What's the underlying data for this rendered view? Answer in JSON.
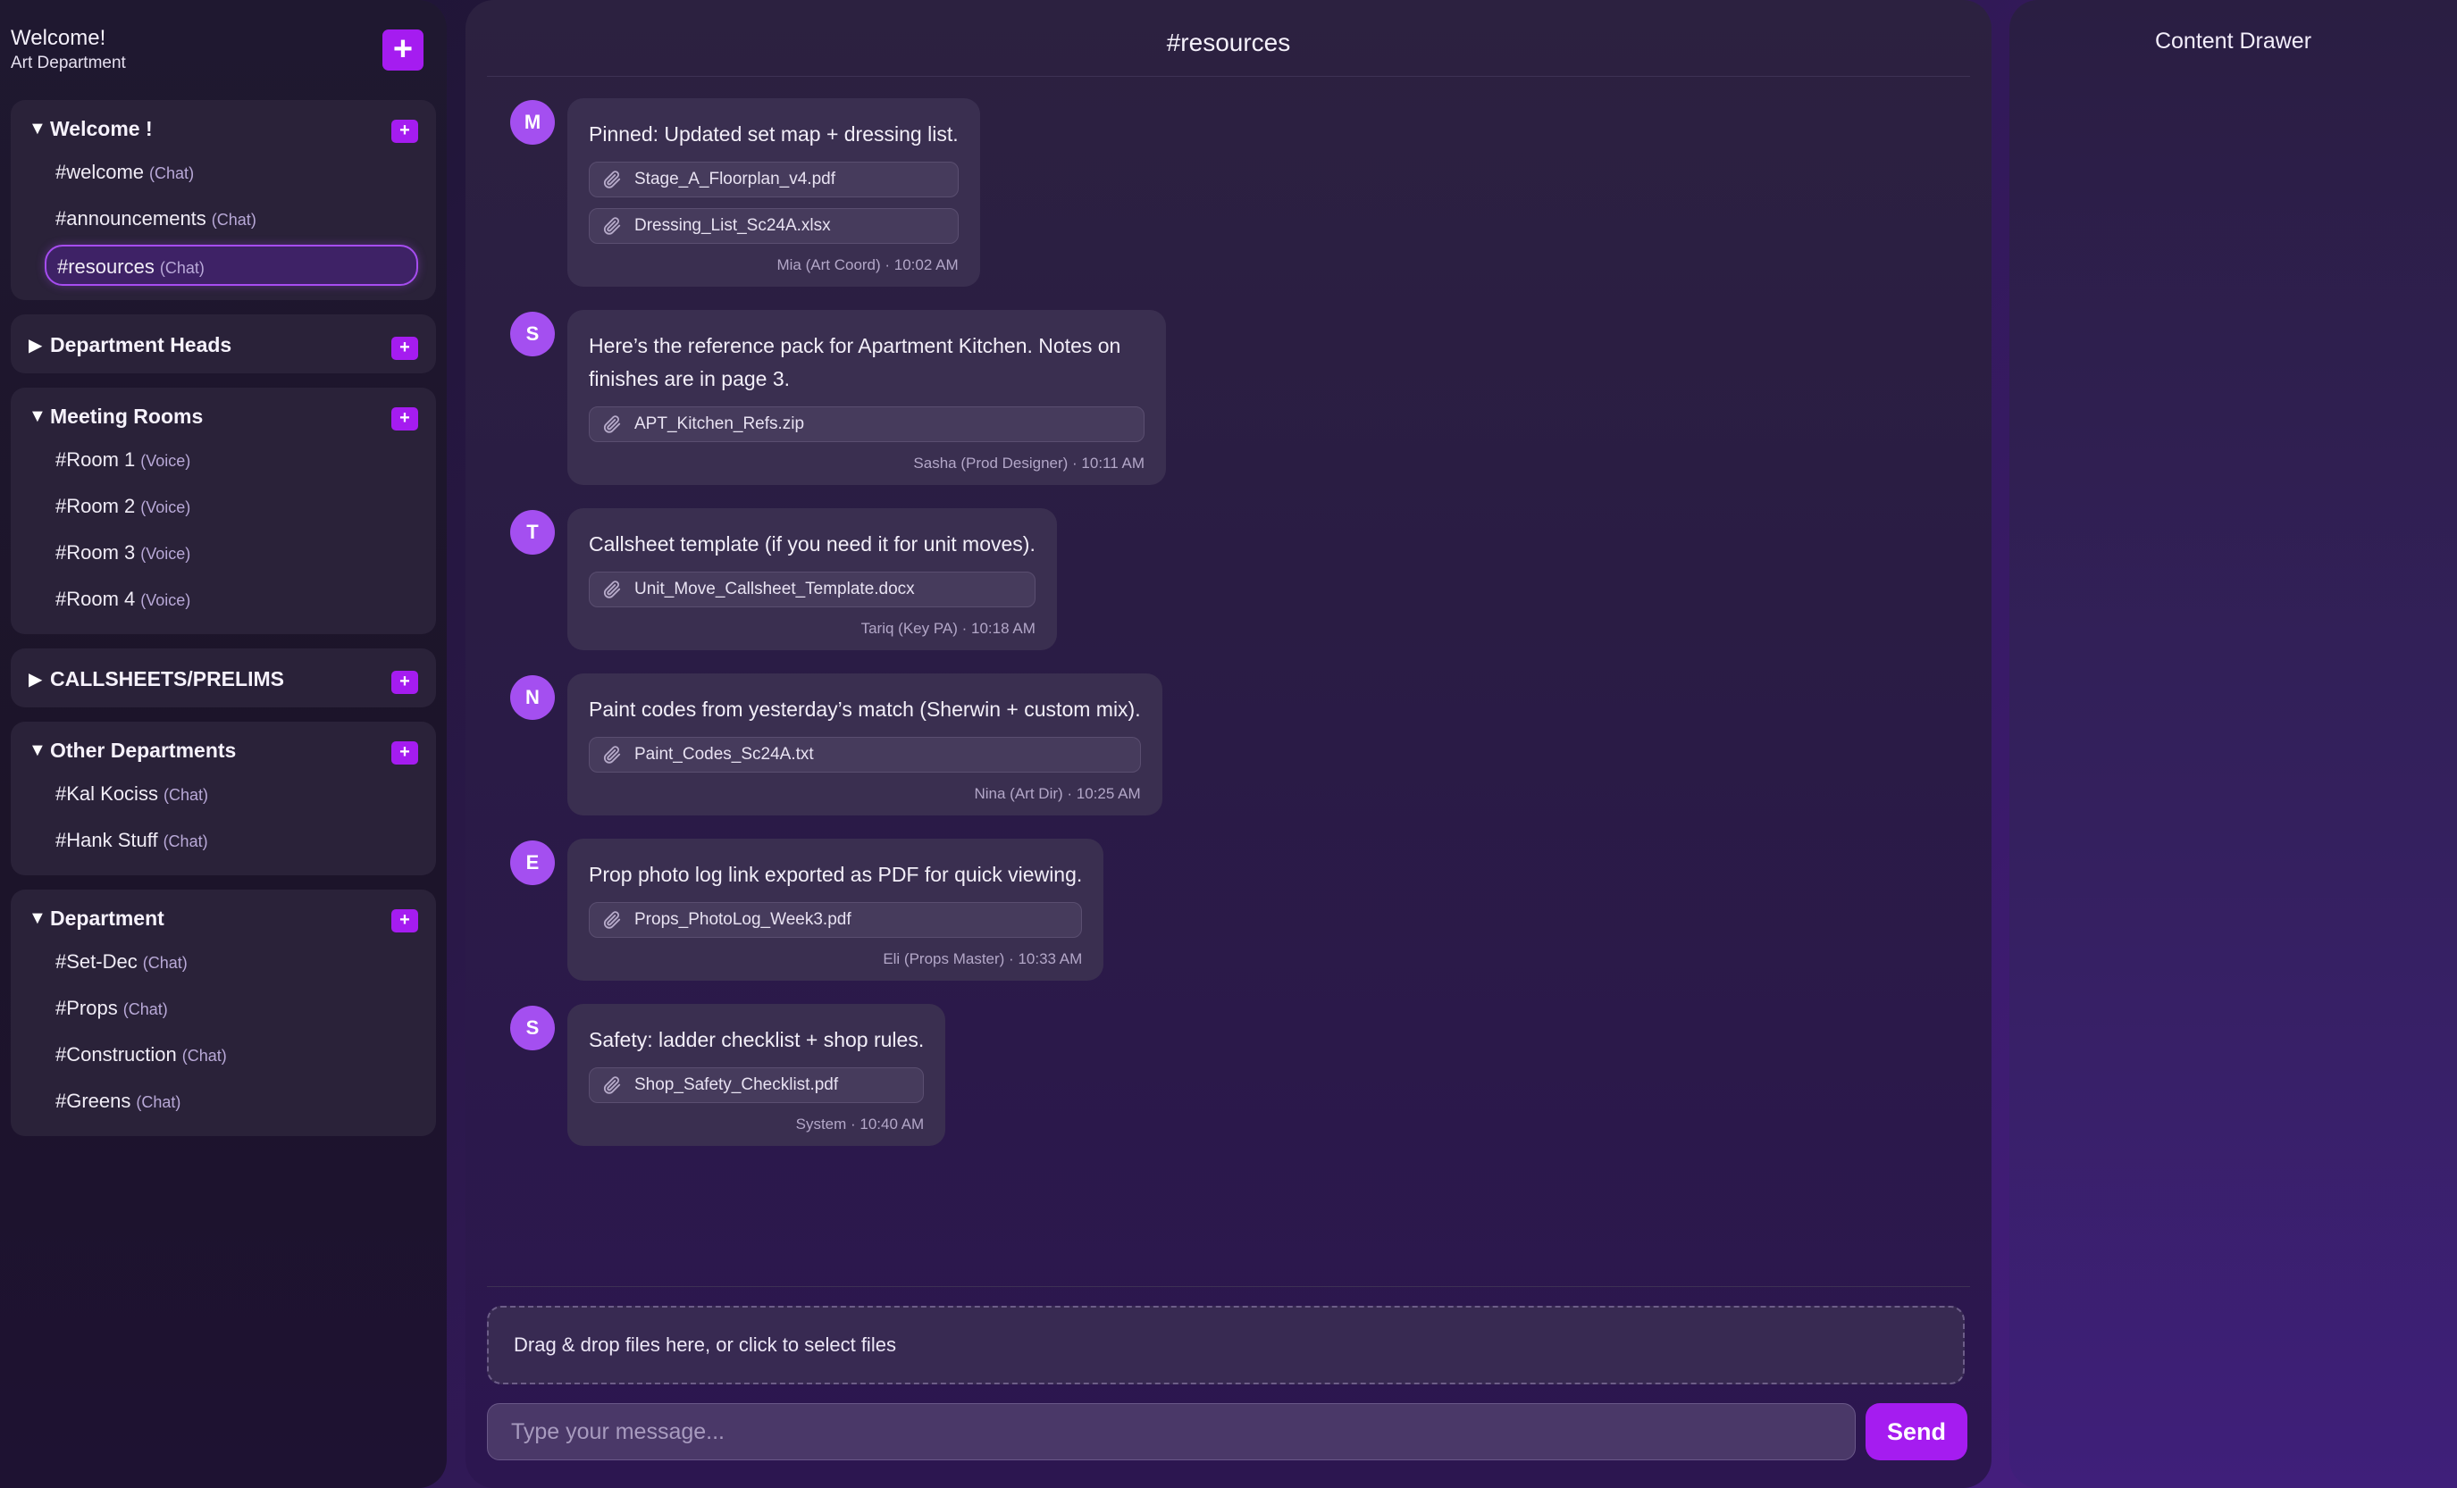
{
  "sidebar": {
    "welcome": "Welcome!",
    "department": "Art Department",
    "add_label": "+",
    "groups": [
      {
        "title": "Welcome !",
        "caret": "▼",
        "channels": [
          {
            "name": "#welcome",
            "kind": "(Chat)"
          },
          {
            "name": "#announcements",
            "kind": "(Chat)"
          },
          {
            "name": "#resources",
            "kind": "(Chat)",
            "active": true
          }
        ]
      },
      {
        "title": "Department Heads",
        "caret": "▶",
        "channels": []
      },
      {
        "title": "Meeting Rooms",
        "caret": "▼",
        "channels": [
          {
            "name": "#Room 1",
            "kind": "(Voice)"
          },
          {
            "name": "#Room 2",
            "kind": "(Voice)"
          },
          {
            "name": "#Room 3",
            "kind": "(Voice)"
          },
          {
            "name": "#Room 4",
            "kind": "(Voice)"
          }
        ]
      },
      {
        "title": "CALLSHEETS/PRELIMS",
        "caret": "▶",
        "channels": []
      },
      {
        "title": "Other Departments",
        "caret": "▼",
        "channels": [
          {
            "name": "#Kal Kociss",
            "kind": "(Chat)"
          },
          {
            "name": "#Hank Stuff",
            "kind": "(Chat)"
          }
        ]
      },
      {
        "title": "Department",
        "caret": "▼",
        "channels": [
          {
            "name": "#Set-Dec",
            "kind": "(Chat)"
          },
          {
            "name": "#Props",
            "kind": "(Chat)"
          },
          {
            "name": "#Construction",
            "kind": "(Chat)"
          },
          {
            "name": "#Greens",
            "kind": "(Chat)"
          }
        ]
      }
    ]
  },
  "channel": {
    "title": "#resources"
  },
  "messages": [
    {
      "avatar": "M",
      "text": "Pinned: Updated set map + dressing list.",
      "attachments": [
        "Stage_A_Floorplan_v4.pdf",
        "Dressing_List_Sc24A.xlsx"
      ],
      "meta": "Mia (Art Coord) · 10:02 AM"
    },
    {
      "avatar": "S",
      "text": "Here’s the reference pack for Apartment Kitchen. Notes on finishes are in page 3.",
      "attachments": [
        "APT_Kitchen_Refs.zip"
      ],
      "meta": "Sasha (Prod Designer) · 10:11 AM"
    },
    {
      "avatar": "T",
      "text": "Callsheet template (if you need it for unit moves).",
      "attachments": [
        "Unit_Move_Callsheet_Template.docx"
      ],
      "meta": "Tariq (Key PA) · 10:18 AM"
    },
    {
      "avatar": "N",
      "text": "Paint codes from yesterday’s match (Sherwin + custom mix).",
      "attachments": [
        "Paint_Codes_Sc24A.txt"
      ],
      "meta": "Nina (Art Dir) · 10:25 AM"
    },
    {
      "avatar": "E",
      "text": "Prop photo log link exported as PDF for quick viewing.",
      "attachments": [
        "Props_PhotoLog_Week3.pdf"
      ],
      "meta": "Eli (Props Master) · 10:33 AM"
    },
    {
      "avatar": "S",
      "text": "Safety: ladder checklist + shop rules.",
      "attachments": [
        "Shop_Safety_Checklist.pdf"
      ],
      "meta": "System · 10:40 AM"
    }
  ],
  "composer": {
    "dropzone": "Drag & drop files here, or click to select files",
    "placeholder": "Type your message...",
    "send_label": "Send"
  },
  "drawer": {
    "title": "Content Drawer"
  },
  "colors": {
    "accent": "#a51cf0",
    "avatar": "#a44ff0",
    "bubble": "#3a2f50"
  },
  "icons": {
    "attachment": "paperclip-icon"
  }
}
